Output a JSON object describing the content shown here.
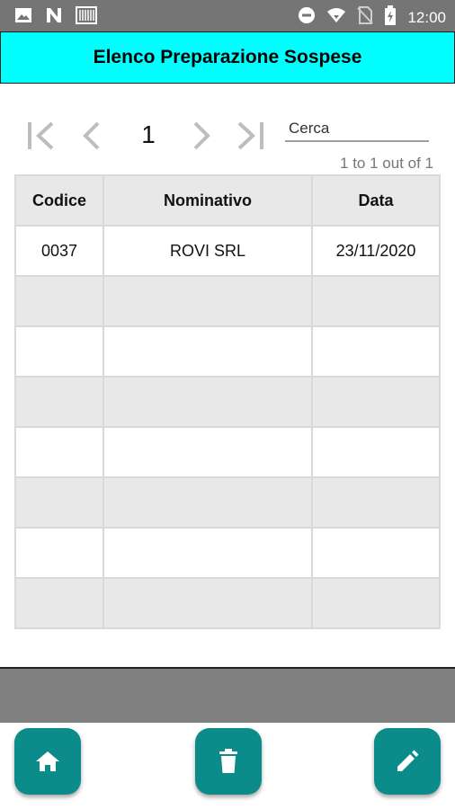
{
  "status_bar": {
    "time": "12:00",
    "left_icons": [
      "image-icon",
      "n-icon",
      "barcode-icon"
    ],
    "right_icons": [
      "dnd-icon",
      "wifi-icon",
      "no-sim-icon",
      "battery-icon"
    ]
  },
  "header": {
    "title": "Elenco Preparazione Sospese",
    "background": "#00ffff"
  },
  "pager": {
    "current_page": "1",
    "range_text": "1 to 1 out of 1"
  },
  "search": {
    "placeholder": "Cerca"
  },
  "table": {
    "columns": [
      "Codice",
      "Nominativo",
      "Data"
    ],
    "rows": [
      [
        "0037",
        "ROVI SRL",
        "23/11/2020"
      ],
      [
        "",
        "",
        ""
      ],
      [
        "",
        "",
        ""
      ],
      [
        "",
        "",
        ""
      ],
      [
        "",
        "",
        ""
      ],
      [
        "",
        "",
        ""
      ],
      [
        "",
        "",
        ""
      ],
      [
        "",
        "",
        ""
      ]
    ]
  },
  "actions": {
    "accent": "#0b8c8a",
    "buttons": [
      "home-icon",
      "trash-icon",
      "edit-icon"
    ]
  }
}
